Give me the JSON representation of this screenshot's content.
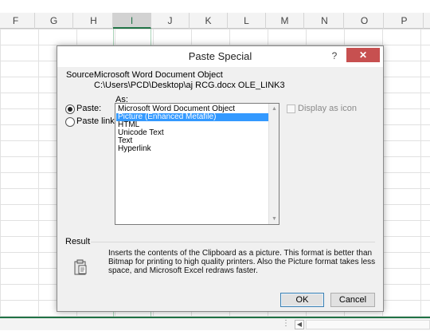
{
  "sheet": {
    "columns": [
      "F",
      "G",
      "H",
      "I",
      "J",
      "K",
      "L",
      "M",
      "N",
      "O",
      "P"
    ],
    "selected_column": "I"
  },
  "dialog": {
    "title": "Paste Special",
    "help_label": "?",
    "close_label": "✕",
    "source_label": "Source:",
    "source_line1": "Microsoft Word Document Object",
    "source_line2": "C:\\Users\\PCD\\Desktop\\aj RCG.docx OLE_LINK3",
    "as_label": "As:",
    "options": [
      {
        "label": "Paste:",
        "checked": true
      },
      {
        "label": "Paste link:",
        "checked": false
      }
    ],
    "formats": [
      "Microsoft Word Document Object",
      "Picture (Enhanced Metafile)",
      "HTML",
      "Unicode Text",
      "Text",
      "Hyperlink"
    ],
    "selected_format_index": 1,
    "display_as_icon_label": "Display as icon",
    "display_as_icon_checked": false,
    "result_label": "Result",
    "result_text": "Inserts the contents of the Clipboard as a picture. This format is better than Bitmap for printing to high quality printers. Also the Picture format takes less space, and Microsoft Excel redraws faster.",
    "ok_label": "OK",
    "cancel_label": "Cancel"
  },
  "colors": {
    "accent_green": "#217346",
    "selection_blue": "#3399ff",
    "close_red": "#c75050"
  }
}
